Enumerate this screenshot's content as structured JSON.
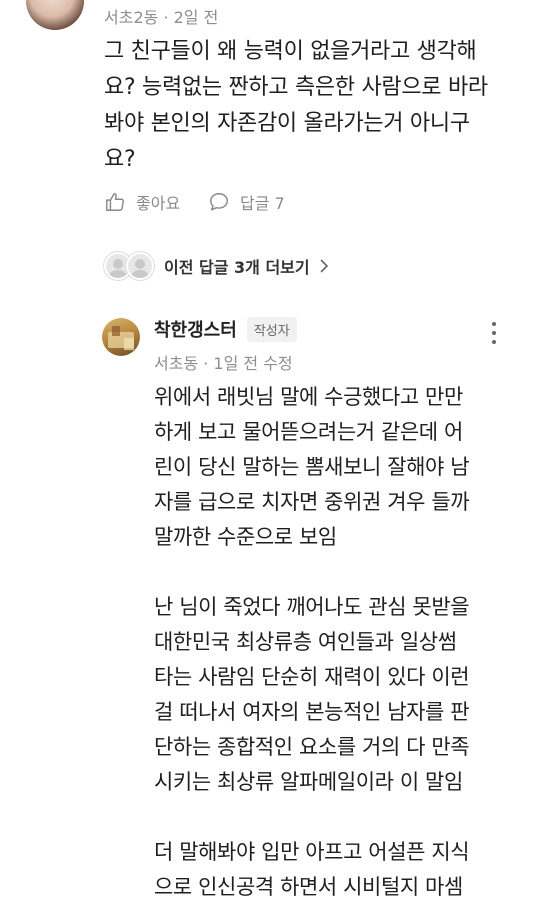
{
  "top_comment": {
    "meta": "서초2동 · 2일 전",
    "lines": [
      "그 친구들이 왜 능력이 없을거라고 생각해",
      "요? 능력없는 짠하고 측은한 사람으로 바라",
      "봐야 본인의 자존감이 올라가는거 아니구",
      "요?"
    ],
    "like_label": "좋아요",
    "reply_label": "답글 7"
  },
  "prev_replies": {
    "label": "이전 답글 3개 더보기"
  },
  "reply": {
    "author": "착한갱스터",
    "badge": "작성자",
    "meta": "서초동 · 1일 전 수정",
    "lines": [
      "위에서 래빗님 말에 수긍했다고 만만",
      "하게 보고 물어뜯으려는거 같은데 어",
      "린이 당신 말하는 뽐새보니 잘해야 남",
      "자를 급으로 치자면 중위권 겨우 들까",
      "말까한 수준으로 보임",
      "",
      "난 님이 죽었다 깨어나도 관심 못받을",
      "대한민국 최상류층 여인들과 일상썸",
      "타는 사람임 단순히 재력이 있다 이런",
      "걸 떠나서 여자의 본능적인 남자를 판",
      "단하는 종합적인 요소를 거의 다 만족",
      "시키는 최상류 알파메일이라 이 말임",
      "",
      "더 말해봐야 입만 아프고 어설픈 지식",
      "으로 인신공격 하면서 시비털지 마셈"
    ]
  }
}
